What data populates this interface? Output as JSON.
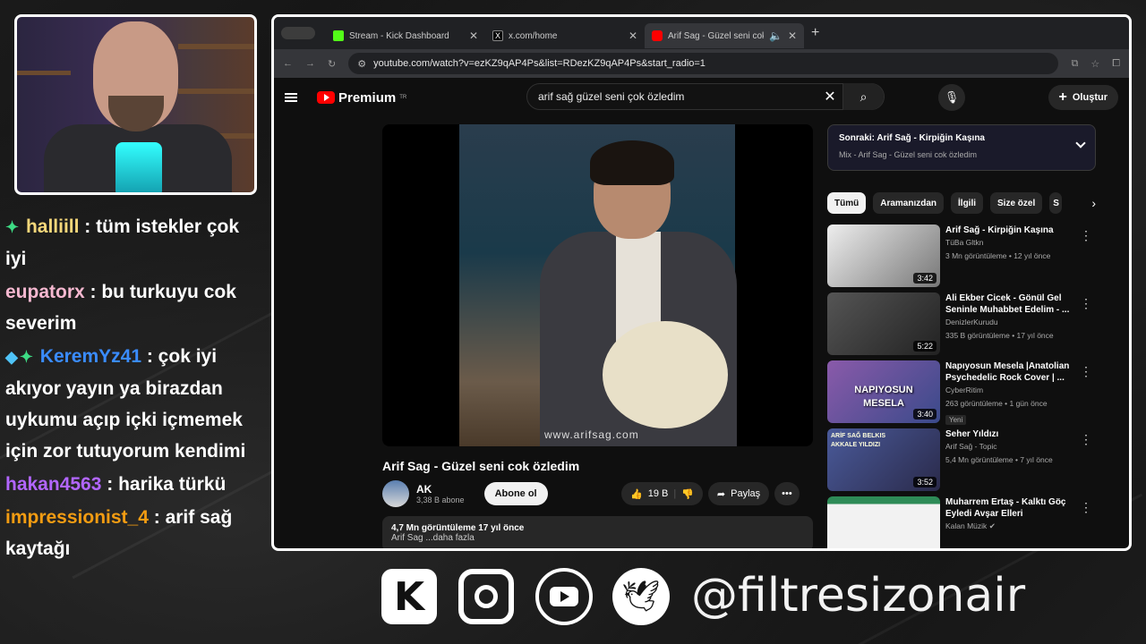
{
  "chat": [
    {
      "badges": [
        "sparkle-badge"
      ],
      "user": "halliill",
      "user_color": "#f5d77a",
      "text": ": tüm istekler çok iyi"
    },
    {
      "badges": [],
      "user": "eupatorx",
      "user_color": "#f5b8d0",
      "text": ": bu turkuyu cok severim"
    },
    {
      "badges": [
        "cube-badge",
        "sparkle-badge"
      ],
      "user": "KeremYz41",
      "user_color": "#3a8cff",
      "text": ": çok iyi akıyor yayın ya birazdan uykumu açıp içki içmemek için zor tutuyorum kendimi"
    },
    {
      "badges": [],
      "user": "hakan4563",
      "user_color": "#b266ff",
      "text": ": harika türkü"
    },
    {
      "badges": [],
      "user": "impressionist_4",
      "user_color": "#f39c12",
      "text": ": arif sağ kaytağı"
    }
  ],
  "browser": {
    "tabs": [
      {
        "title": "Stream - Kick Dashboard",
        "icon": "kick-icon",
        "active": false
      },
      {
        "title": "x.com/home",
        "icon": "x-icon",
        "active": false
      },
      {
        "title": "Arif Sag - Güzel seni cok",
        "icon": "youtube-icon",
        "active": true
      }
    ],
    "url": "youtube.com/watch?v=ezKZ9qAP4Ps&list=RDezKZ9qAP4Ps&start_radio=1"
  },
  "youtube": {
    "logo_text": "Premium",
    "logo_region": "TR",
    "search_query": "arif sağ güzel seni çok özledim",
    "create_label": "Oluştur",
    "video": {
      "watermark": "www.arifsag.com",
      "title": "Arif Sag - Güzel seni cok özledim",
      "channel": "AK",
      "subscribers": "3,38 B abone",
      "subscribe_label": "Abone ol",
      "likes": "19 B",
      "share_label": "Paylaş",
      "stats": "4,7 Mn görüntüleme  17 yıl önce",
      "desc_snippet": "Arif Sag ...daha fazla"
    },
    "up_next": {
      "label": "Sonraki: Arif Sağ - Kirpiğin Kaşına",
      "sub": "Mix - Arif Sag - Güzel seni cok özledim"
    },
    "chips": [
      "Tümü",
      "Aramanızdan",
      "İlgili",
      "Size özel",
      "S"
    ],
    "recommendations": [
      {
        "title": "Arif Sağ - Kirpiğin Kaşına",
        "channel": "TüBa Gltkn",
        "meta": "3 Mn görüntüleme • 12 yıl önce",
        "duration": "3:42",
        "thumb_color": "#d8d8d8",
        "badge": ""
      },
      {
        "title": "Ali Ekber Cicek - Gönül Gel Seninle Muhabbet Edelim - ...",
        "channel": "DenizlerKurudu",
        "meta": "335 B görüntüleme • 17 yıl önce",
        "duration": "5:22",
        "thumb_color": "#3a3a3a",
        "badge": ""
      },
      {
        "title": "Napıyosun Mesela |Anatolian Psychedelic Rock Cover | ...",
        "channel": "CyberRitim",
        "meta": "263 görüntüleme • 1 gün önce",
        "duration": "3:40",
        "thumb_color": "#6a4a8a",
        "thumb_text": "NAPIYOSUN MESELA",
        "badge": "Yeni"
      },
      {
        "title": "Seher Yıldızı",
        "channel": "Arif Sağ - Topic",
        "meta": "5,4 Mn görüntüleme • 7 yıl önce",
        "duration": "3:52",
        "thumb_color": "#3a4a7a",
        "thumb_text": "ARİF SAĞ  BELKIS AKKALE  YILDIZI",
        "badge": ""
      },
      {
        "title": "Muharrem Ertaş - Kalktı Göç Eyledi Avşar Elleri",
        "channel": "Kalan Müzik",
        "meta": "",
        "duration": "",
        "thumb_color": "#e8e8e8",
        "badge": ""
      }
    ]
  },
  "social": {
    "icons": [
      "kick-icon",
      "instagram-icon",
      "youtube-icon",
      "twitter-icon"
    ],
    "handle": "@filtresizonair"
  }
}
